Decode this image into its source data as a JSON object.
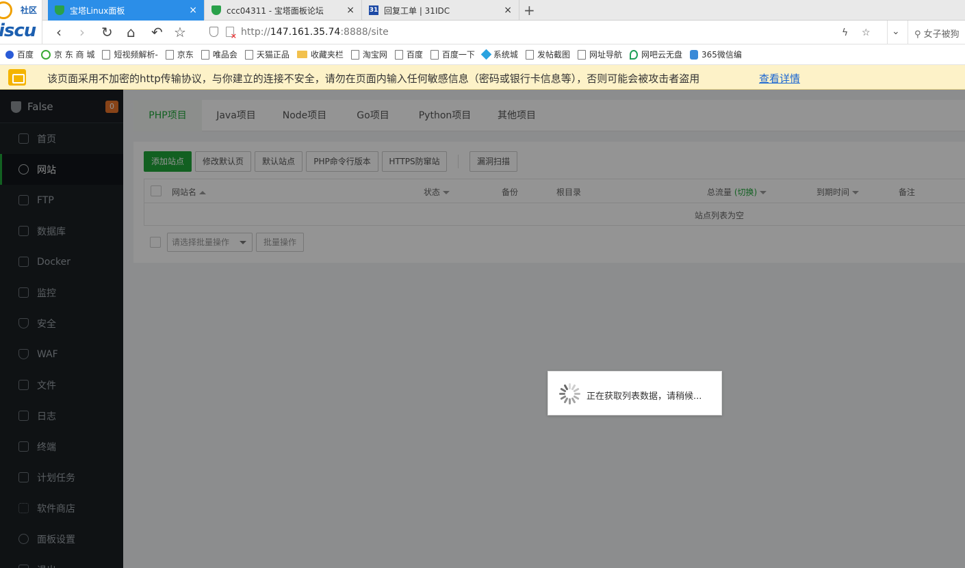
{
  "browser": {
    "logo": {
      "top": "社区",
      "bottom": "iscu"
    },
    "tabs": [
      {
        "title": "宝塔Linux面板",
        "icon": "bt-shield-icon"
      },
      {
        "title": "ccc04311 - 宝塔面板论坛",
        "icon": "bt-shield-icon"
      },
      {
        "title": "回复工单 | 31IDC",
        "icon": "31idc-icon"
      }
    ],
    "url": {
      "scheme": "http://",
      "host": "147.161.35.74",
      "rest": ":8888/site"
    },
    "search_text": "女子被狗",
    "bookmarks": [
      {
        "label": "百度",
        "icon": "paw-icon"
      },
      {
        "label": "京 东 商 城",
        "icon": "green-circle-icon"
      },
      {
        "label": "短视频解析-",
        "icon": "page-icon"
      },
      {
        "label": "京东",
        "icon": "page-icon"
      },
      {
        "label": "唯品会",
        "icon": "page-icon"
      },
      {
        "label": "天猫正品",
        "icon": "page-icon"
      },
      {
        "label": "收藏夹栏",
        "icon": "folder-icon"
      },
      {
        "label": "淘宝网",
        "icon": "page-icon"
      },
      {
        "label": "百度",
        "icon": "page-icon"
      },
      {
        "label": "百度一下",
        "icon": "page-icon"
      },
      {
        "label": "系统城",
        "icon": "diamond-icon"
      },
      {
        "label": "发帖截图",
        "icon": "page-icon"
      },
      {
        "label": "网址导航",
        "icon": "page-icon"
      },
      {
        "label": "网吧云无盘",
        "icon": "leaf-icon"
      },
      {
        "label": "365微信编",
        "icon": "365-icon"
      }
    ],
    "warning": {
      "text": "该页面采用不加密的http传输协议，与你建立的连接不安全，请勿在页面内输入任何敏感信息（密码或银行卡信息等），否则可能会被攻击者盗用",
      "link": "查看详情"
    }
  },
  "sidebar": {
    "server_name": "False",
    "badge": "0",
    "items": [
      {
        "label": "首页",
        "icon": "home-icon"
      },
      {
        "label": "网站",
        "icon": "globe-icon",
        "active": true
      },
      {
        "label": "FTP",
        "icon": "ftp-icon"
      },
      {
        "label": "数据库",
        "icon": "database-icon"
      },
      {
        "label": "Docker",
        "icon": "docker-icon"
      },
      {
        "label": "监控",
        "icon": "monitor-icon"
      },
      {
        "label": "安全",
        "icon": "security-shield-icon"
      },
      {
        "label": "WAF",
        "icon": "waf-shield-icon"
      },
      {
        "label": "文件",
        "icon": "folder-icon"
      },
      {
        "label": "日志",
        "icon": "log-icon"
      },
      {
        "label": "终端",
        "icon": "terminal-icon"
      },
      {
        "label": "计划任务",
        "icon": "calendar-icon"
      },
      {
        "label": "软件商店",
        "icon": "grid-icon"
      },
      {
        "label": "面板设置",
        "icon": "gear-icon"
      },
      {
        "label": "退出",
        "icon": "logout-icon"
      }
    ]
  },
  "main": {
    "project_tabs": [
      "PHP项目",
      "Java项目",
      "Node项目",
      "Go项目",
      "Python项目",
      "其他项目"
    ],
    "toolbar": {
      "add_site": "添加站点",
      "modify_default_page": "修改默认页",
      "default_site": "默认站点",
      "php_cli_version": "PHP命令行版本",
      "https_anti_snoop": "HTTPS防窜站",
      "vuln_scan": "漏洞扫描"
    },
    "table": {
      "columns": {
        "site_name": "网站名",
        "status": "状态",
        "backup": "备份",
        "root_dir": "根目录",
        "traffic": "总流量",
        "traffic_switch": "(切换)",
        "expire": "到期时间",
        "note": "备注"
      },
      "empty_text": "站点列表为空"
    },
    "batch": {
      "select_placeholder": "请选择批量操作",
      "button": "批量操作"
    }
  },
  "loading": {
    "text": "正在获取列表数据，请稍候..."
  },
  "colors": {
    "accent": "#20a53a",
    "sidebar_bg": "#1b2024",
    "browser_tab_active": "#2b8ee8",
    "warning_bg": "#fdf2c8"
  }
}
